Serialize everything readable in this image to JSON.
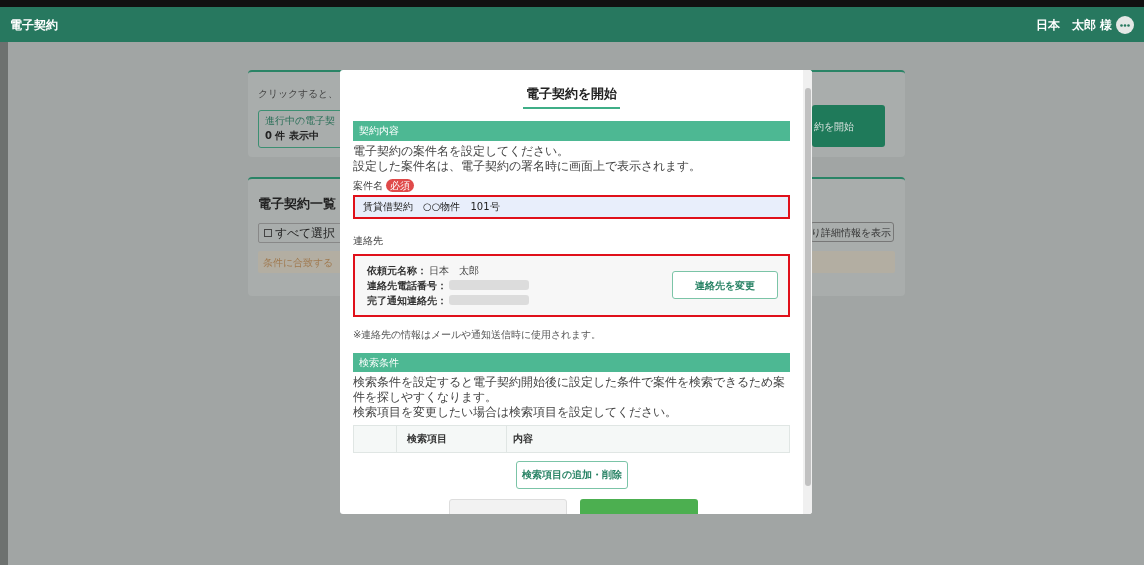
{
  "header": {
    "title": "電子契約",
    "user_name": "日本　太郎 様"
  },
  "background": {
    "hint": "クリックすると、",
    "status_title": "進行中の電子契",
    "status_count": "0 件 表示中",
    "start_button": "約を開始",
    "list_title": "電子契約一覧",
    "select_all": "すべて選択",
    "select_all_checked": false,
    "details_button": "り詳細情報を表示",
    "notice": "条件に合致する"
  },
  "modal": {
    "title": "電子契約を開始",
    "contract_section": {
      "heading": "契約内容",
      "description": [
        "電子契約の案件名を設定してください。",
        "設定した案件名は、電子契約の署名時に画面上で表示されます。"
      ],
      "name_label": "案件名",
      "required_badge": "必須",
      "name_value": "賃貸借契約　○○物件　101号"
    },
    "contact": {
      "label": "連絡先",
      "fields": [
        {
          "label": "依頼元名称：",
          "value": "日本　太郎"
        },
        {
          "label": "連絡先電話番号："
        },
        {
          "label": "完了通知連絡先："
        }
      ],
      "change_button": "連絡先を変更",
      "note": "※連絡先の情報はメールや通知送信時に使用されます。"
    },
    "search_section": {
      "heading": "検索条件",
      "description": [
        "検索条件を設定すると電子契約開始後に設定した条件で案件を検索できるため案件を探しやすくなります。",
        "検索項目を変更したい場合は検索項目を設定してください。"
      ],
      "columns": [
        "検索項目",
        "内容"
      ],
      "edit_button": "検索項目の追加・削除"
    }
  }
}
